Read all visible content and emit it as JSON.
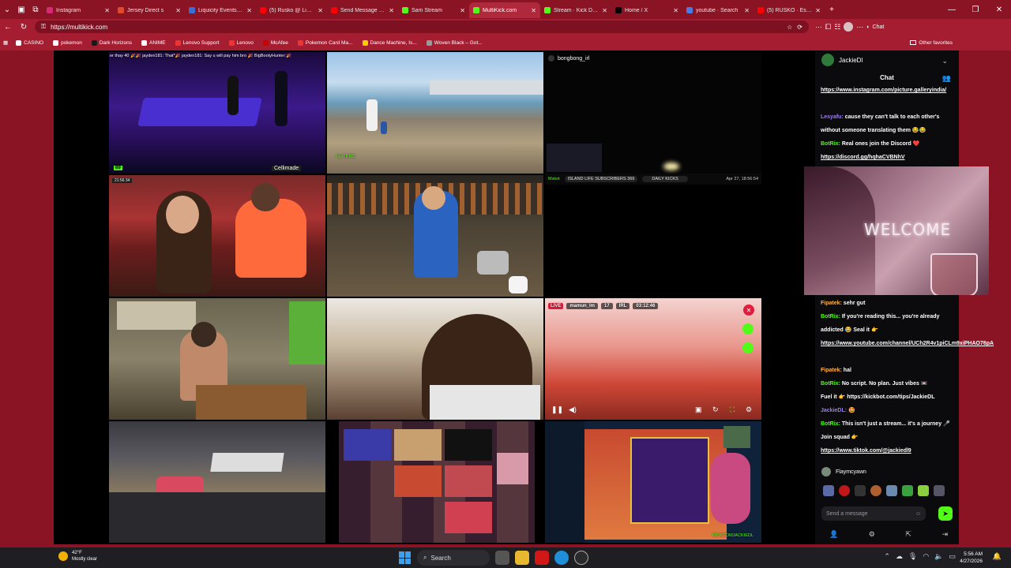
{
  "browser": {
    "tabs": [
      {
        "title": "Instagram",
        "color": "#d62976",
        "active": false
      },
      {
        "title": "Jersey Direct s",
        "color": "#e04a2a",
        "active": false
      },
      {
        "title": "Liquicity Events Ru",
        "color": "#3a6fd8",
        "active": false
      },
      {
        "title": "(5) Rusko @ Liquic",
        "color": "#ff0000",
        "active": false
      },
      {
        "title": "Send Message | Fro",
        "color": "#ff0000",
        "active": false
      },
      {
        "title": "Sam Stream",
        "color": "#53fc18",
        "active": false
      },
      {
        "title": "MultiKick.com",
        "color": "#53fc18",
        "active": true
      },
      {
        "title": "Stream · Kick Dash",
        "color": "#53fc18",
        "active": false
      },
      {
        "title": "Home / X",
        "color": "#000000",
        "active": false
      },
      {
        "title": "youtube · Search",
        "color": "#4a7be0",
        "active": false
      },
      {
        "title": "(5) RUSKO · Essen",
        "color": "#ff0000",
        "active": false
      }
    ],
    "address": "https://multikick.com",
    "copilot_label": "Chat",
    "bookmarks": [
      "CASINO",
      "pokemon",
      "Dark Horizons",
      "ANIME",
      "Lenovo Support",
      "Lenovo",
      "McAfee",
      "Pokemon Card Ma...",
      "Dance Machine, Is...",
      "Woven Black – Got..."
    ],
    "other_favorites": "Other favorites"
  },
  "streams": [
    {
      "id": "tile1",
      "overlay_top": "er thay 40 🎉🎉 jayden181: That*🎉 jayden181: Say u will pay him bro 🎉 BigBootyHunter:🎉",
      "badge": "69",
      "badge2": "Cellimade"
    },
    {
      "id": "tile2",
      "overlay": "NATERS"
    },
    {
      "id": "tile3",
      "streamer": "bongbong_irl",
      "footer_left": "Mskot",
      "footer_mid": "ISLAND LIFE SUBSCRIBERS 369",
      "footer_mid2": "DAILY KICKS",
      "footer_right": "Apr 27, 18:56:54"
    },
    {
      "id": "tile4",
      "overlay_top": "21:56 34"
    },
    {
      "id": "tile5"
    },
    {
      "id": "tile7"
    },
    {
      "id": "tile8"
    },
    {
      "id": "tile9",
      "live": "LIVE",
      "user": "mamun_lm",
      "viewers": "17",
      "flag": "IRL",
      "time": "03:12:46"
    },
    {
      "id": "tile10"
    },
    {
      "id": "tile11"
    },
    {
      "id": "tile12",
      "footer": "KICKCOMJACKIEDL"
    }
  ],
  "chat": {
    "username": "JackieDl",
    "title": "Chat",
    "messages": [
      {
        "user": "",
        "text": "https://www.instagram.com/picture.galleryindia/"
      },
      {
        "user": "Lesyafu:",
        "text": "cause they can't talk to each other's without someone translating them 😂😂"
      },
      {
        "user": "BotRix:",
        "text": "Real ones join the Discord ❤️"
      },
      {
        "user": "",
        "text": "https://discord.gg/hqhaCVBNhV"
      },
      {
        "user": "Fipatek:",
        "text": "sehr gut"
      },
      {
        "user": "BotRix:",
        "text": "If you're reading this... you're already addicted 😂 Seal it 👉"
      },
      {
        "user": "",
        "text": "https://www.youtube.com/channel/UCh2R4v1piCLm9xiPHAO76pA"
      },
      {
        "user": "Fipatek:",
        "text": "hal"
      },
      {
        "user": "BotRix:",
        "text": "No script. No plan. Just vibes 📼"
      },
      {
        "user": "",
        "text": "Fuel it 👉 https://kickbot.com/tips/JackieDL"
      },
      {
        "user": "JackieDL:",
        "text": "🤩"
      },
      {
        "user": "BotRix:",
        "text": "This isn't just a stream... it's a journey 🎤 Join squad 👉"
      },
      {
        "user": "",
        "text": "https://www.tiktok.com/@jackiedl9"
      }
    ],
    "welcome_text": "WELCOME",
    "bottom_user": "Flaymcyawn",
    "send_placeholder": "Send a message"
  },
  "taskbar": {
    "temp": "42°F",
    "weather": "Mostly clear",
    "search": "Search",
    "time": "5:56 AM",
    "date": "4/27/2026"
  }
}
